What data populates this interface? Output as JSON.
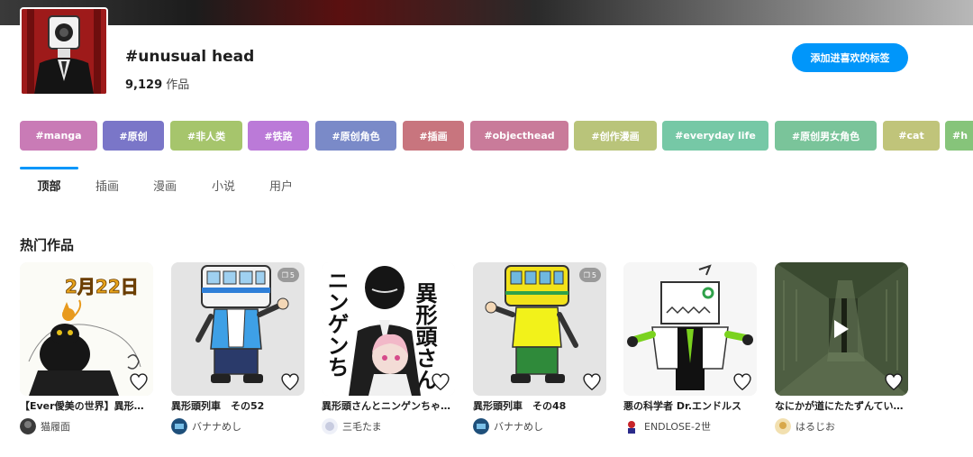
{
  "header": {
    "tag_title": "#unusual head",
    "work_count": "9,129",
    "work_count_unit": " 作品",
    "fav_button_label": "添加进喜欢的标签"
  },
  "related_tags": [
    {
      "label": "#manga",
      "color": "#c97bb6"
    },
    {
      "label": "#原创",
      "color": "#7a76c8"
    },
    {
      "label": "#非人类",
      "color": "#a6c56c"
    },
    {
      "label": "#铁路",
      "color": "#bb7ad8"
    },
    {
      "label": "#原创角色",
      "color": "#7a8ac8"
    },
    {
      "label": "#插画",
      "color": "#c8757e"
    },
    {
      "label": "#objecthead",
      "color": "#c97b9a"
    },
    {
      "label": "#创作漫画",
      "color": "#b9c47a"
    },
    {
      "label": "#everyday life",
      "color": "#76c8a6"
    },
    {
      "label": "#原创男女角色",
      "color": "#7ac49a"
    },
    {
      "label": "#cat",
      "color": "#c0c47a"
    },
    {
      "label": "#h",
      "color": "#86c47a"
    }
  ],
  "tabs": [
    {
      "label": "顶部",
      "active": true
    },
    {
      "label": "插画",
      "active": false
    },
    {
      "label": "漫画",
      "active": false
    },
    {
      "label": "小说",
      "active": false
    },
    {
      "label": "用户",
      "active": false
    }
  ],
  "section_title": "热门作品",
  "works": [
    {
      "title": "【Ever僾美の世界】異形の…",
      "user": "猫履面",
      "page_count": "",
      "has_play": false
    },
    {
      "title": "異形頭列車　その52",
      "user": "バナナめし",
      "page_count": "5",
      "has_play": false
    },
    {
      "title": "異形頭さんとニンゲンちゃ…",
      "user": "三毛たま",
      "page_count": "",
      "has_play": false
    },
    {
      "title": "異形頭列車　その48",
      "user": "バナナめし",
      "page_count": "5",
      "has_play": false
    },
    {
      "title": "悪の科学者 Dr.エンドルス",
      "user": "ENDLOSE-2世",
      "page_count": "",
      "has_play": false
    },
    {
      "title": "なにかが道にたたずんてい…",
      "user": "はるじお",
      "page_count": "",
      "has_play": true
    }
  ],
  "artwork_texts": {
    "work1_date": "2月22日",
    "work3_vertical_1": "異形頭さん",
    "work3_vertical_2": "ニンゲンち"
  },
  "colors": {
    "accent": "#0096fa",
    "text_primary": "#1f1f1f",
    "text_secondary": "#474747"
  }
}
